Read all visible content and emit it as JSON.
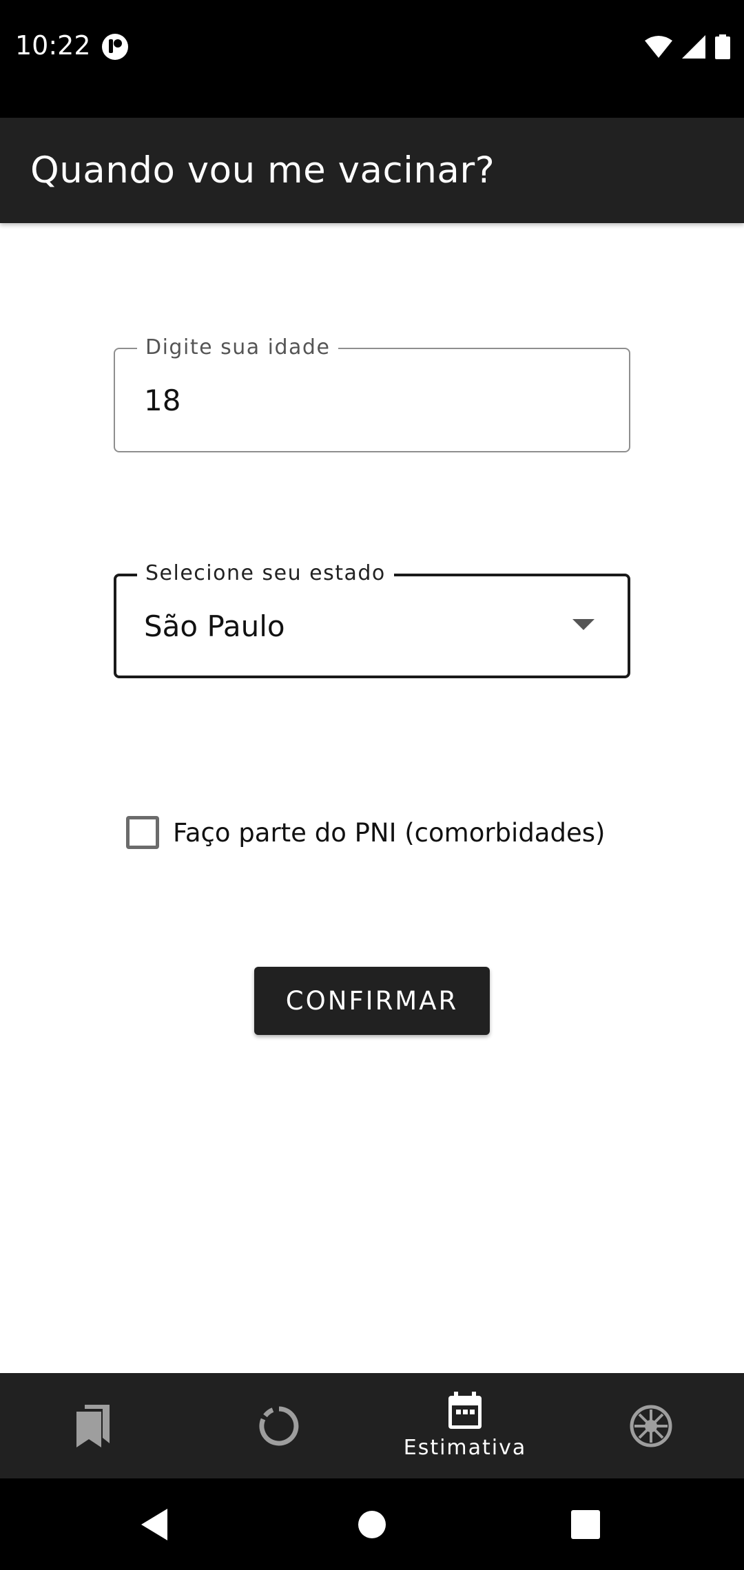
{
  "status_bar": {
    "time": "10:22"
  },
  "app_bar": {
    "title": "Quando vou me vacinar?"
  },
  "form": {
    "age_field": {
      "label": "Digite sua idade",
      "value": "18"
    },
    "state_field": {
      "label": "Selecione seu estado",
      "value": "São Paulo"
    },
    "pni_checkbox": {
      "label": "Faço parte do PNI (comorbidades)",
      "checked": false
    },
    "confirm_label": "CONFIRMAR"
  },
  "bottom_nav": {
    "items": [
      {
        "icon": "bookmarks-icon",
        "label": ""
      },
      {
        "icon": "progress-circle-icon",
        "label": ""
      },
      {
        "icon": "calendar-icon",
        "label": "Estimativa",
        "selected": true
      },
      {
        "icon": "virus-icon",
        "label": ""
      }
    ]
  },
  "colors": {
    "app_bar": "#212121",
    "background": "#ffffff",
    "accent": "#1a1a1a"
  }
}
